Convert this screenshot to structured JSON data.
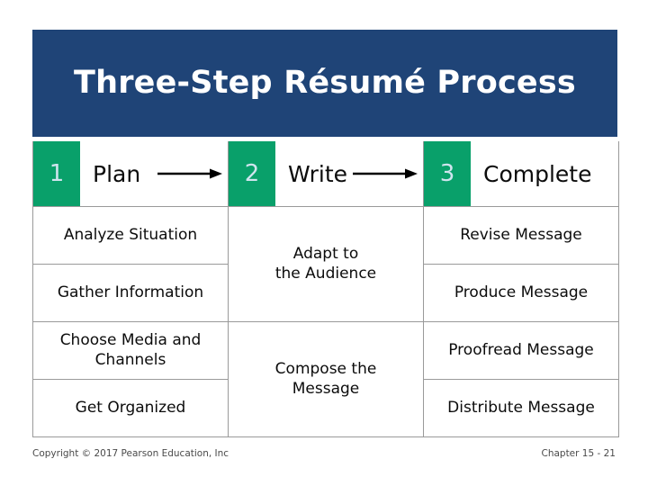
{
  "slide": {
    "title": "Three-Step Résumé Process",
    "colors": {
      "banner_blue": "#1F4477",
      "badge_green": "#09A06A",
      "badge_number": "#CFE4EE",
      "grid_line": "#9A9A9A",
      "body_text": "#0C0C0C",
      "footer_text": "#4A4A4A"
    }
  },
  "steps": [
    {
      "number": "1",
      "label": "Plan",
      "arrow": true
    },
    {
      "number": "2",
      "label": "Write",
      "arrow": true
    },
    {
      "number": "3",
      "label": "Complete",
      "arrow": false
    }
  ],
  "columns": {
    "plan": [
      "Analyze Situation",
      "Gather Information",
      "Choose Media and Channels",
      "Get Organized"
    ],
    "write": [
      "Adapt to\nthe Audience",
      "Compose the\nMessage"
    ],
    "complete": [
      "Revise Message",
      "Produce Message",
      "Proofread Message",
      "Distribute Message"
    ]
  },
  "footer": {
    "copyright": "Copyright © 2017 Pearson Education, Inc",
    "chapter": "Chapter 15 - 21"
  }
}
